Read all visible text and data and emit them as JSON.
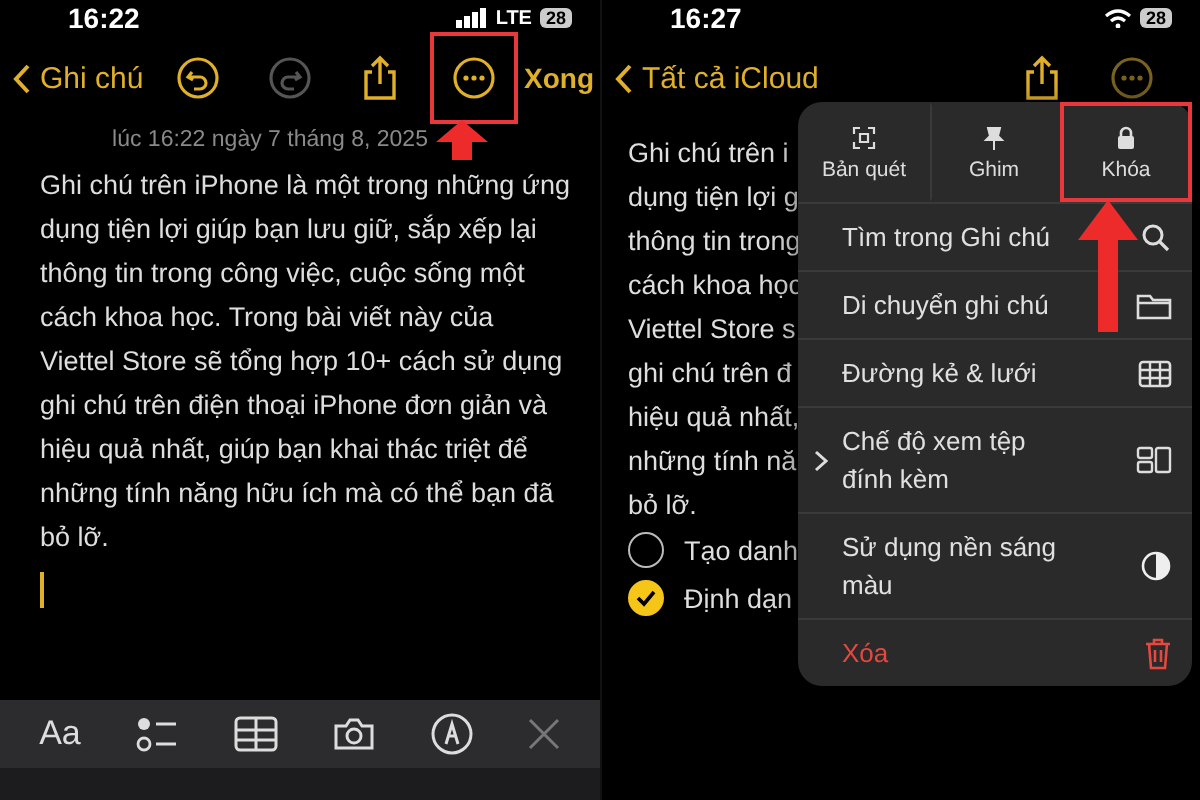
{
  "left_screen": {
    "status_bar": {
      "time": "16:22",
      "network": "LTE",
      "battery": "28"
    },
    "nav": {
      "back": "Ghi chú",
      "done": "Xong",
      "buttons": [
        {
          "kind": "undo",
          "disabled": false,
          "highlighted": false
        },
        {
          "kind": "redo",
          "disabled": true,
          "highlighted": false
        },
        {
          "kind": "share",
          "disabled": false,
          "highlighted": false
        },
        {
          "kind": "more",
          "disabled": false,
          "highlighted": true
        }
      ]
    },
    "timestamp": "lúc 16:22 ngày 7 tháng 8, 2025",
    "note_text": "Ghi chú trên iPhone là một trong những ứng dụng tiện lợi giúp bạn lưu giữ, sắp xếp lại thông tin trong công việc, cuộc sống một cách khoa học. Trong bài viết này của Viettel Store sẽ tổng hợp 10+ cách sử dụng ghi chú trên điện thoại iPhone đơn giản và hiệu quả nhất, giúp bạn khai thác triệt để những tính năng hữu ích mà có thể bạn đã bỏ lỡ.",
    "toolbar": {
      "format_label": "Aa",
      "tools": [
        {
          "kind": "checklist"
        },
        {
          "kind": "table"
        },
        {
          "kind": "camera"
        },
        {
          "kind": "markup"
        },
        {
          "kind": "close"
        }
      ]
    }
  },
  "right_screen": {
    "status_bar": {
      "time": "16:27",
      "battery": "28"
    },
    "nav": {
      "back": "Tất cả iCloud"
    },
    "note_lines": [
      "Ghi chú trên i",
      "dụng tiện lợi g",
      "thông tin trong",
      "cách khoa học",
      "Viettel Store s",
      "ghi chú trên đ",
      "hiệu quả nhất,",
      "những tính nă",
      "bỏ lỡ."
    ],
    "checklist": [
      {
        "label": "Tạo danh",
        "checked": false
      },
      {
        "label": "Định dạn",
        "checked": true
      }
    ],
    "menu": {
      "actions": [
        {
          "label": "Bản quét",
          "kind": "scan",
          "highlighted": false
        },
        {
          "label": "Ghim",
          "kind": "pin",
          "highlighted": false
        },
        {
          "label": "Khóa",
          "kind": "lock",
          "highlighted": true
        }
      ],
      "items": [
        {
          "label": "Tìm trong Ghi chú",
          "kind": "search",
          "expandable": false
        },
        {
          "label": "Di chuyển ghi chú",
          "kind": "folder",
          "expandable": false
        },
        {
          "label": "Đường kẻ & lưới",
          "kind": "grid",
          "expandable": false
        },
        {
          "label": "Chế độ xem tệp đính kèm",
          "kind": "attachments",
          "expandable": true
        },
        {
          "label": "Sử dụng nền sáng màu",
          "kind": "contrast",
          "expandable": false
        },
        {
          "label": "Xóa",
          "kind": "delete",
          "expandable": false
        }
      ]
    }
  }
}
